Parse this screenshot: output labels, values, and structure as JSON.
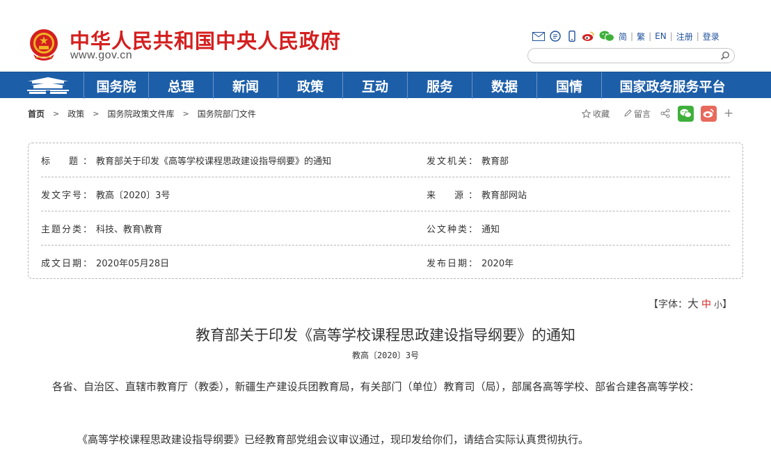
{
  "header": {
    "site_title": "中华人民共和国中央人民政府",
    "site_url": "www.gov.cn",
    "util_links": [
      "简",
      "繁",
      "EN",
      "注册",
      "登录"
    ],
    "search_placeholder": ""
  },
  "nav": {
    "items": [
      "国务院",
      "总理",
      "新闻",
      "政策",
      "互动",
      "服务",
      "数据",
      "国情",
      "国家政务服务平台"
    ]
  },
  "breadcrumb": [
    "首页",
    "政策",
    "国务院政策文件库",
    "国务院部门文件"
  ],
  "share": {
    "favorite": "收藏",
    "comment": "留言"
  },
  "info": {
    "title_label": "标　题：",
    "title_value": "教育部关于印发《高等学校课程思政建设指导纲要》的通知",
    "issuer_label": "发文机关：",
    "issuer_value": "教育部",
    "docno_label": "发文字号：",
    "docno_value": "教高〔2020〕3号",
    "source_label": "来　源：",
    "source_value": "教育部网站",
    "topic_label": "主题分类：",
    "topic_value": "科技、教育\\教育",
    "type_label": "公文种类：",
    "type_value": "通知",
    "written_label": "成文日期：",
    "written_value": "2020年05月28日",
    "published_label": "发布日期：",
    "published_value": "2020年"
  },
  "fontsize": {
    "open": "【字体：",
    "big": "大",
    "mid": "中",
    "small": "小",
    "close": "】"
  },
  "article": {
    "title": "教育部关于印发《高等学校课程思政建设指导纲要》的通知",
    "doc_no": "教高〔2020〕3号",
    "salutation": "各省、自治区、直辖市教育厅（教委），新疆生产建设兵团教育局，有关部门（单位）教育司（局），部属各高等学校、部省合建各高等学校：",
    "para1": "《高等学校课程思政建设指导纲要》已经教育部党组会议审议通过，现印发给你们，请结合实际认真贯彻执行。"
  },
  "colors": {
    "brand_red": "#d41f1f",
    "nav_blue": "#1d5ea8",
    "link_blue": "#1d4f9a"
  }
}
